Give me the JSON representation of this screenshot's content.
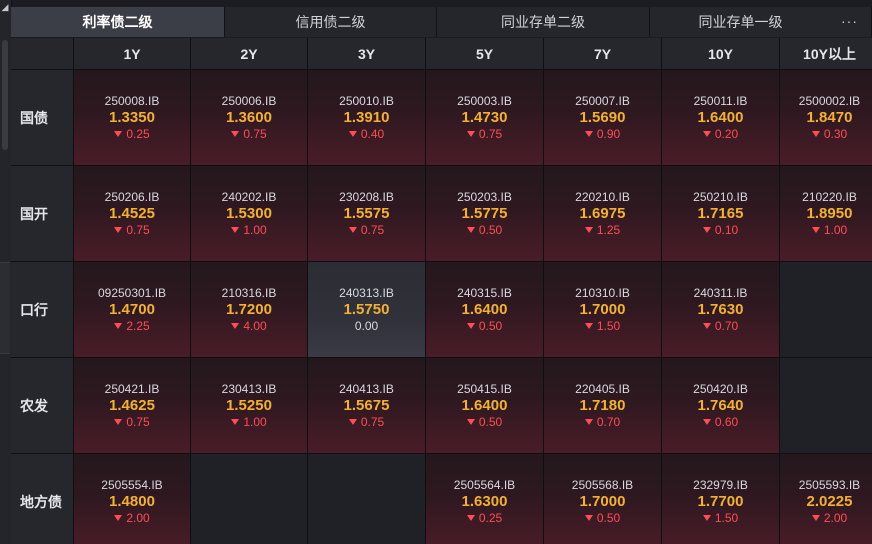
{
  "tabs": [
    {
      "label": "利率债二级",
      "active": true
    },
    {
      "label": "信用债二级",
      "active": false
    },
    {
      "label": "同业存单二级",
      "active": false
    },
    {
      "label": "同业存单一级",
      "active": false
    }
  ],
  "more_label": "···",
  "columns": [
    "1Y",
    "2Y",
    "3Y",
    "5Y",
    "7Y",
    "10Y",
    "10Y以上"
  ],
  "rows": [
    {
      "label": "国债",
      "cells": [
        {
          "code": "250008.IB",
          "rate": "1.3350",
          "change": "0.25",
          "dir": "down"
        },
        {
          "code": "250006.IB",
          "rate": "1.3600",
          "change": "0.75",
          "dir": "down"
        },
        {
          "code": "250010.IB",
          "rate": "1.3910",
          "change": "0.40",
          "dir": "down"
        },
        {
          "code": "250003.IB",
          "rate": "1.4730",
          "change": "0.75",
          "dir": "down"
        },
        {
          "code": "250007.IB",
          "rate": "1.5690",
          "change": "0.90",
          "dir": "down"
        },
        {
          "code": "250011.IB",
          "rate": "1.6400",
          "change": "0.20",
          "dir": "down"
        },
        {
          "code": "2500002.IB",
          "rate": "1.8470",
          "change": "0.30",
          "dir": "down"
        }
      ]
    },
    {
      "label": "国开",
      "cells": [
        {
          "code": "250206.IB",
          "rate": "1.4525",
          "change": "0.75",
          "dir": "down"
        },
        {
          "code": "240202.IB",
          "rate": "1.5300",
          "change": "1.00",
          "dir": "down"
        },
        {
          "code": "230208.IB",
          "rate": "1.5575",
          "change": "0.75",
          "dir": "down"
        },
        {
          "code": "250203.IB",
          "rate": "1.5775",
          "change": "0.50",
          "dir": "down"
        },
        {
          "code": "220210.IB",
          "rate": "1.6975",
          "change": "1.25",
          "dir": "down"
        },
        {
          "code": "250210.IB",
          "rate": "1.7165",
          "change": "0.10",
          "dir": "down"
        },
        {
          "code": "210220.IB",
          "rate": "1.8950",
          "change": "1.00",
          "dir": "down"
        }
      ]
    },
    {
      "label": "口行",
      "cells": [
        {
          "code": "09250301.IB",
          "rate": "1.4700",
          "change": "2.25",
          "dir": "down"
        },
        {
          "code": "210316.IB",
          "rate": "1.7200",
          "change": "4.00",
          "dir": "down"
        },
        {
          "code": "240313.IB",
          "rate": "1.5750",
          "change": "0.00",
          "dir": "flat"
        },
        {
          "code": "240315.IB",
          "rate": "1.6400",
          "change": "0.50",
          "dir": "down"
        },
        {
          "code": "210310.IB",
          "rate": "1.7000",
          "change": "1.50",
          "dir": "down"
        },
        {
          "code": "240311.IB",
          "rate": "1.7630",
          "change": "0.70",
          "dir": "down"
        },
        null
      ]
    },
    {
      "label": "农发",
      "cells": [
        {
          "code": "250421.IB",
          "rate": "1.4625",
          "change": "0.75",
          "dir": "down"
        },
        {
          "code": "230413.IB",
          "rate": "1.5250",
          "change": "1.00",
          "dir": "down"
        },
        {
          "code": "240413.IB",
          "rate": "1.5675",
          "change": "0.75",
          "dir": "down"
        },
        {
          "code": "250415.IB",
          "rate": "1.6400",
          "change": "0.50",
          "dir": "down"
        },
        {
          "code": "220405.IB",
          "rate": "1.7180",
          "change": "0.70",
          "dir": "down"
        },
        {
          "code": "250420.IB",
          "rate": "1.7640",
          "change": "0.60",
          "dir": "down"
        },
        null
      ]
    },
    {
      "label": "地方债",
      "cells": [
        {
          "code": "2505554.IB",
          "rate": "1.4800",
          "change": "2.00",
          "dir": "down"
        },
        null,
        null,
        {
          "code": "2505564.IB",
          "rate": "1.6300",
          "change": "0.25",
          "dir": "down"
        },
        {
          "code": "2505568.IB",
          "rate": "1.7000",
          "change": "0.50",
          "dir": "down"
        },
        {
          "code": "232979.IB",
          "rate": "1.7700",
          "change": "1.50",
          "dir": "down"
        },
        {
          "code": "2505593.IB",
          "rate": "2.0225",
          "change": "2.00",
          "dir": "down"
        }
      ]
    }
  ],
  "colors": {
    "rate": "#f3b133",
    "down": "#ff4d55",
    "flat": "#d9d9de",
    "active_tab": "#3c3e47"
  }
}
